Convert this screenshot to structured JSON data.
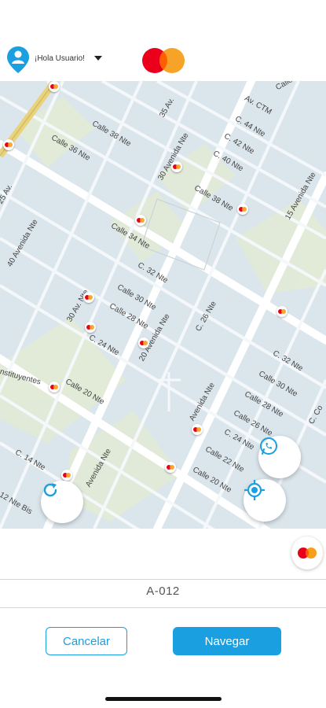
{
  "header": {
    "greeting": "¡Hola Usuario!",
    "user_icon": "user-pin-icon",
    "brand_logo": "mastercard-logo"
  },
  "map": {
    "street_labels": [
      "Calle 38 Nte",
      "Calle 36 Nte",
      "Calle 34 Nte",
      "Calle 38 Nte",
      "C. 32 Nte",
      "Calle 30 Nte",
      "Calle 28 Nte",
      "C. 24 Nte",
      "Calle 20 Nte",
      "C. 14 Nte",
      "C. 44 Nte",
      "C. 42 Nte",
      "C. 40 Nte",
      "Av. CTM",
      "Calle 48 Nte",
      "35 Av.",
      "30 Avenida Nte",
      "40 Avenida Nte",
      "30 Av. Nte",
      "20 Avenida Nte",
      "15 Avenida Nte",
      "C. 32 Nte",
      "Calle 30 Nte",
      "Calle 28 Nte",
      "Calle 26 Nte",
      "C. 24 Nte",
      "Calle 22 Nte",
      "Calle 20 Nte",
      "Avenida Nte",
      "Avenida Nte",
      "nstituyentes",
      "25 Av.",
      "C. 26 Nte",
      "12 Nte Bis",
      "C. Co"
    ],
    "refresh_icon": "refresh-icon",
    "whatsapp_icon": "whatsapp-icon",
    "locate_icon": "my-location-icon"
  },
  "info": {
    "code": "A-012",
    "badge_icon": "mastercard-badge-icon"
  },
  "actions": {
    "cancel_label": "Cancelar",
    "navigate_label": "Navegar"
  },
  "colors": {
    "accent": "#1a9fe0",
    "map_bg": "#dbe6ec",
    "road": "#ffffff",
    "block": "#e3ecd9",
    "highway": "#e8d27a",
    "mc_red": "#eb001b",
    "mc_orange": "#f79e1b"
  }
}
